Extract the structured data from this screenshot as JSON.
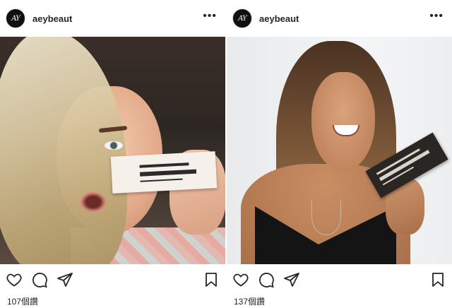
{
  "posts": [
    {
      "avatar_text": "AY",
      "username": "aeybeaut",
      "more_label": "•••",
      "views": "107個讚",
      "photo_icon": "selfie-with-product-photo"
    },
    {
      "avatar_text": "AY",
      "username": "aeybeaut",
      "more_label": "•••",
      "views": "137個讚",
      "photo_icon": "portrait-with-product-photo"
    }
  ],
  "icons": {
    "like": "heart-icon",
    "comment": "comment-icon",
    "share": "send-icon",
    "save": "bookmark-icon",
    "more": "more-icon"
  },
  "colors": {
    "text": "#262626",
    "background": "#ffffff"
  }
}
